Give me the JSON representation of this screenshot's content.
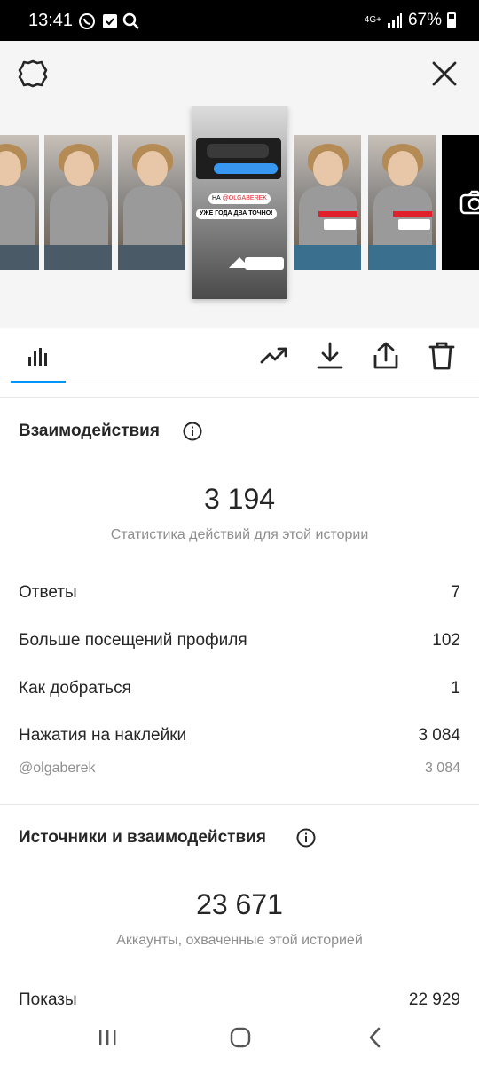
{
  "status_bar": {
    "time": "13:41",
    "network": "4G+",
    "battery": "67%"
  },
  "story": {
    "selected_mention_prefix": "НА ",
    "selected_mention": "@OLGABEREK",
    "selected_pill": "УЖЕ ГОДА ДВА ТОЧНО!"
  },
  "engagement": {
    "title": "Взаимодействия",
    "total": "3 194",
    "caption": "Статистика действий для этой истории",
    "rows": [
      {
        "label": "Ответы",
        "value": "7"
      },
      {
        "label": "Больше посещений профиля",
        "value": "102"
      },
      {
        "label": "Как добраться",
        "value": "1"
      },
      {
        "label": "Нажатия на наклейки",
        "value": "3 084"
      }
    ],
    "sub_row": {
      "label": "@olgaberek",
      "value": "3 084"
    }
  },
  "reach": {
    "title": "Источники и взаимодействия",
    "total": "23 671",
    "caption": "Аккаунты, охваченные этой историей",
    "rows": [
      {
        "label": "Показы",
        "value": "22 929"
      }
    ]
  },
  "colors": {
    "accent": "#0095f6",
    "text": "#262626",
    "muted": "#8e8e8e"
  }
}
